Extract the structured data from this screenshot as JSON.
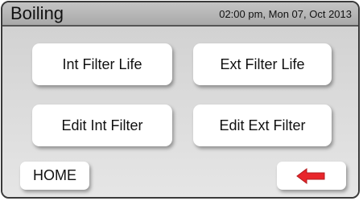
{
  "header": {
    "title": "Boiling",
    "datetime": "02:00 pm, Mon 07, Oct 2013"
  },
  "buttons": {
    "int_filter_life": "Int Filter Life",
    "ext_filter_life": "Ext Filter Life",
    "edit_int_filter": "Edit Int Filter",
    "edit_ext_filter": "Edit Ext Filter",
    "home": "HOME"
  },
  "icons": {
    "back": "back-arrow-icon"
  },
  "colors": {
    "back_arrow": "#e8262b",
    "header_bg": "#b5b5b5",
    "button_bg": "#ffffff"
  }
}
